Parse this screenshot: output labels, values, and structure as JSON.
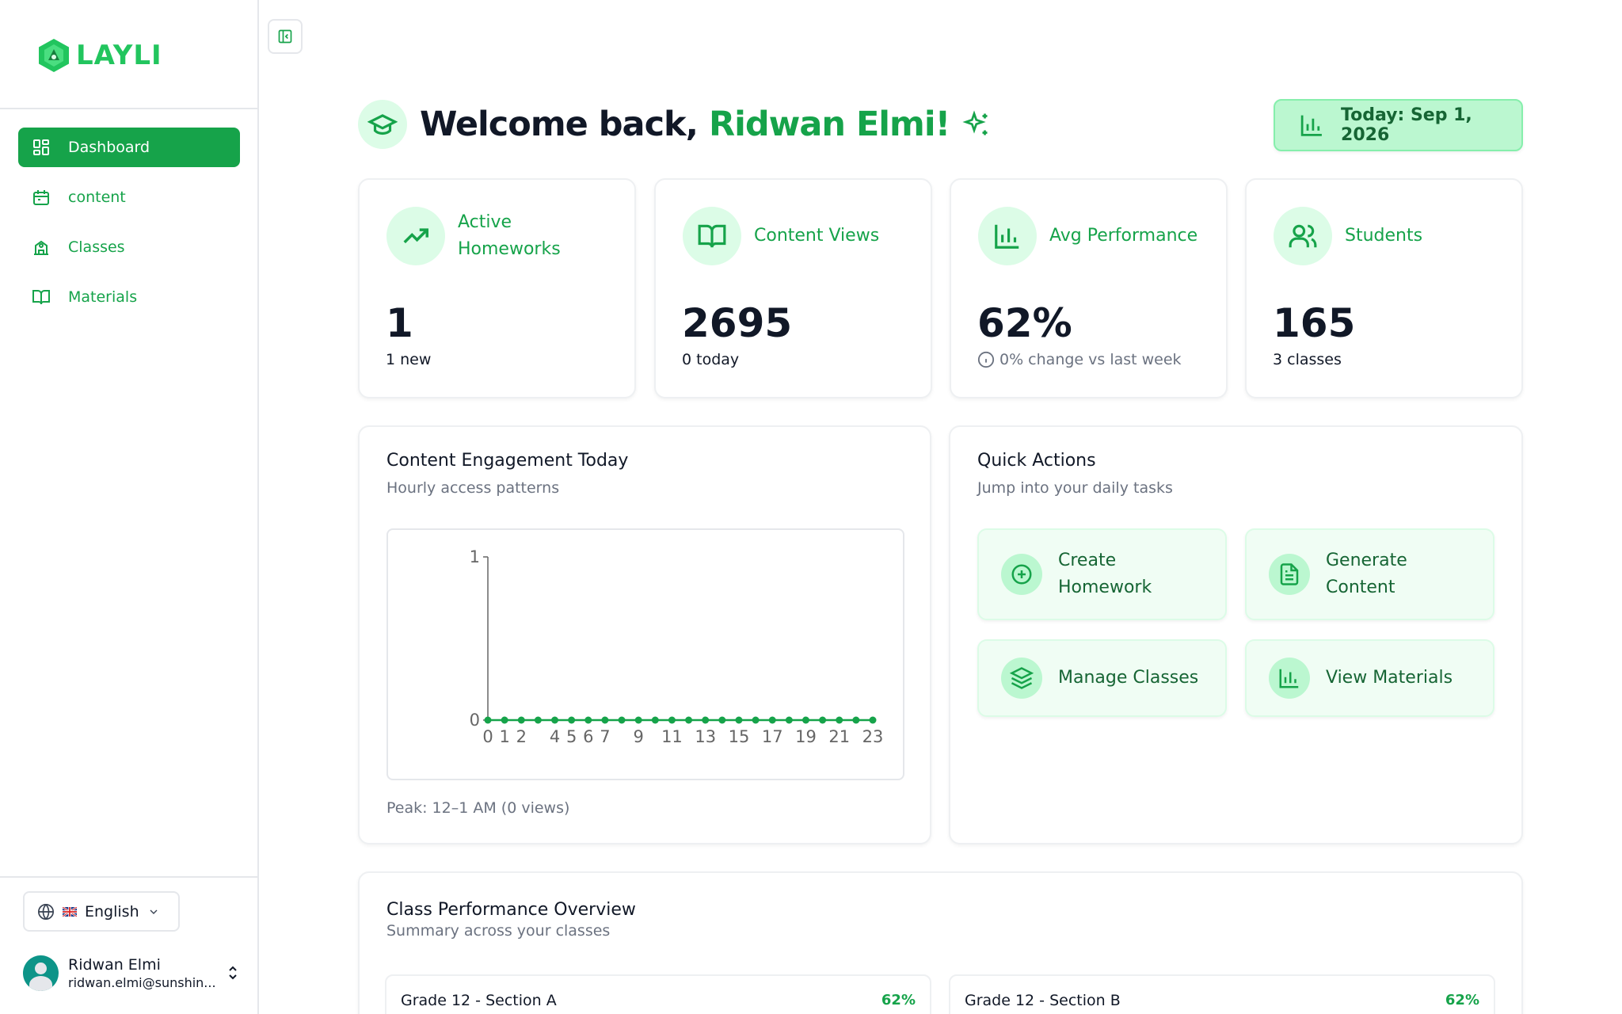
{
  "app": {
    "name": "LAYLI"
  },
  "sidebar": {
    "items": [
      {
        "label": "Dashboard",
        "icon": "layout-grid-icon",
        "active": true
      },
      {
        "label": "content",
        "icon": "calendar-box-icon",
        "active": false
      },
      {
        "label": "Classes",
        "icon": "school-building-icon",
        "active": false
      },
      {
        "label": "Materials",
        "icon": "book-open-icon",
        "active": false
      }
    ],
    "language": {
      "label": "English",
      "flag": "uk-flag-icon"
    },
    "user": {
      "name": "Ridwan Elmi",
      "email": "ridwan.elmi@sunshin..."
    }
  },
  "header": {
    "greeting": "Welcome back,",
    "name": "Ridwan Elmi!",
    "today": "Today: Sep 1, 2026"
  },
  "stats": [
    {
      "label": "Active Homeworks",
      "value": "1",
      "sub": "1 new",
      "icon": "trending-up-icon"
    },
    {
      "label": "Content Views",
      "value": "2695",
      "sub": "0 today",
      "icon": "book-open-icon"
    },
    {
      "label": "Avg Performance",
      "value": "62%",
      "sub": "0% change vs last week",
      "icon": "bar-chart-icon"
    },
    {
      "label": "Students",
      "value": "165",
      "sub": "3 classes",
      "icon": "users-icon"
    }
  ],
  "engagement": {
    "title": "Content Engagement Today",
    "subtitle": "Hourly access patterns",
    "peak": "Peak: 12–1 AM (0 views)"
  },
  "chart_data": {
    "type": "line",
    "x": [
      0,
      1,
      2,
      3,
      4,
      5,
      6,
      7,
      8,
      9,
      10,
      11,
      12,
      13,
      14,
      15,
      16,
      17,
      18,
      19,
      20,
      21,
      22,
      23
    ],
    "y": [
      0,
      0,
      0,
      0,
      0,
      0,
      0,
      0,
      0,
      0,
      0,
      0,
      0,
      0,
      0,
      0,
      0,
      0,
      0,
      0,
      0,
      0,
      0,
      0
    ],
    "x_tick_labels": [
      "0",
      "1",
      "2",
      "4",
      "5",
      "6",
      "7",
      "9",
      "11",
      "13",
      "15",
      "17",
      "19",
      "21",
      "23"
    ],
    "y_ticks": [
      "0",
      "1"
    ],
    "ylim": [
      0,
      1
    ],
    "xlim": [
      0,
      23
    ],
    "grid": false,
    "color": "#16a34a"
  },
  "quick_actions": {
    "title": "Quick Actions",
    "subtitle": "Jump into your daily tasks",
    "items": [
      {
        "label": "Create Homework",
        "icon": "plus-circle-icon"
      },
      {
        "label": "Generate Content",
        "icon": "file-text-icon"
      },
      {
        "label": "Manage Classes",
        "icon": "layers-icon"
      },
      {
        "label": "View Materials",
        "icon": "bar-chart-icon"
      }
    ]
  },
  "class_overview": {
    "title": "Class Performance Overview",
    "subtitle": "Summary across your classes",
    "classes": [
      {
        "name": "Grade 12 - Section A",
        "percent": "62%"
      },
      {
        "name": "Grade 12 - Section B",
        "percent": "62%"
      }
    ]
  },
  "colors": {
    "accent": "#16a34a",
    "accent_light": "#dcfce7",
    "text": "#111827",
    "muted": "#6b7280"
  }
}
